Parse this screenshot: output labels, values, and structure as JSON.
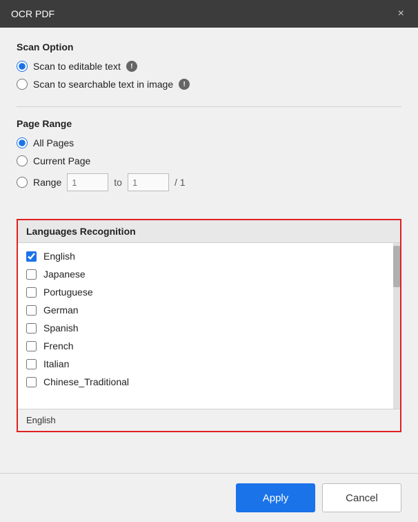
{
  "titleBar": {
    "title": "OCR PDF",
    "closeIcon": "×"
  },
  "scanOption": {
    "sectionTitle": "Scan Option",
    "options": [
      {
        "id": "scan-editable",
        "label": "Scan to editable text",
        "checked": true,
        "hasInfo": true
      },
      {
        "id": "scan-searchable",
        "label": "Scan to searchable text in image",
        "checked": false,
        "hasInfo": true
      }
    ]
  },
  "pageRange": {
    "sectionTitle": "Page Range",
    "options": [
      {
        "id": "all-pages",
        "label": "All Pages",
        "checked": true
      },
      {
        "id": "current-page",
        "label": "Current Page",
        "checked": false
      },
      {
        "id": "range",
        "label": "Range",
        "checked": false
      }
    ],
    "rangeFrom": {
      "placeholder": "1"
    },
    "rangeTo": {
      "placeholder": "1"
    },
    "separator": "to",
    "total": "/ 1"
  },
  "languagesRecognition": {
    "sectionTitle": "Languages Recognition",
    "languages": [
      {
        "label": "English",
        "checked": true
      },
      {
        "label": "Japanese",
        "checked": false
      },
      {
        "label": "Portuguese",
        "checked": false
      },
      {
        "label": "German",
        "checked": false
      },
      {
        "label": "Spanish",
        "checked": false
      },
      {
        "label": "French",
        "checked": false
      },
      {
        "label": "Italian",
        "checked": false
      },
      {
        "label": "Chinese_Traditional",
        "checked": false
      }
    ],
    "selectedDisplay": "English"
  },
  "footer": {
    "applyLabel": "Apply",
    "cancelLabel": "Cancel"
  }
}
